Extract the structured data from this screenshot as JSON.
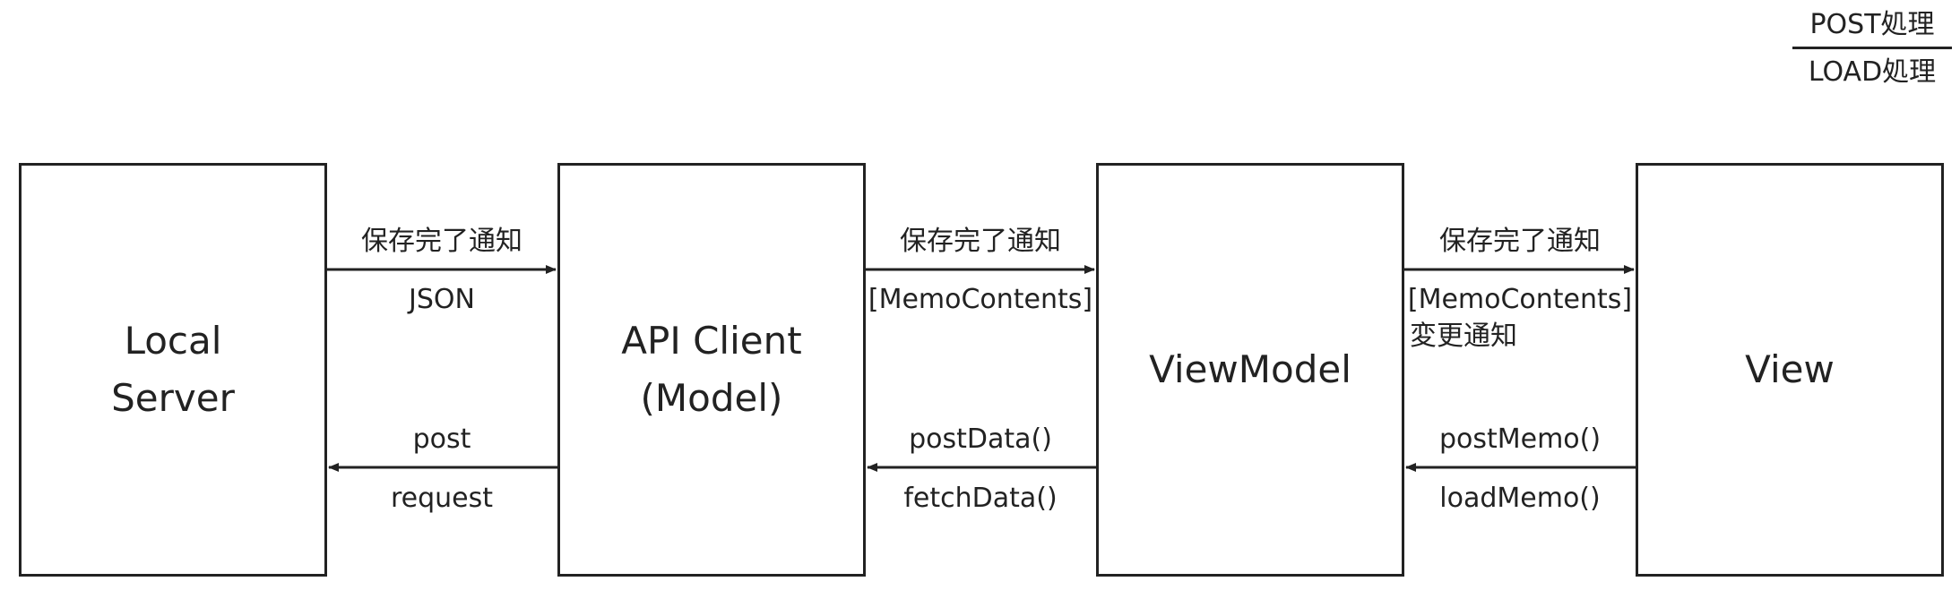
{
  "legend": {
    "post_label": "POST処理",
    "load_label": "LOAD処理"
  },
  "nodes": {
    "local_server": "Local\nServer",
    "api_client": "API Client\n(Model)",
    "viewmodel": "ViewModel",
    "view": "View"
  },
  "edges": {
    "server_to_api": {
      "top": "保存完了通知",
      "bottom": "JSON"
    },
    "api_to_server": {
      "top": "post",
      "bottom": "request"
    },
    "api_to_vm": {
      "top": "保存完了通知",
      "bottom": "[MemoContents]"
    },
    "vm_to_api": {
      "top": "postData()",
      "bottom": "fetchData()"
    },
    "vm_to_view": {
      "top": "保存完了通知",
      "bottom": "[MemoContents]",
      "bottom2": "変更通知"
    },
    "view_to_vm": {
      "top": "postMemo()",
      "bottom": "loadMemo()"
    }
  }
}
